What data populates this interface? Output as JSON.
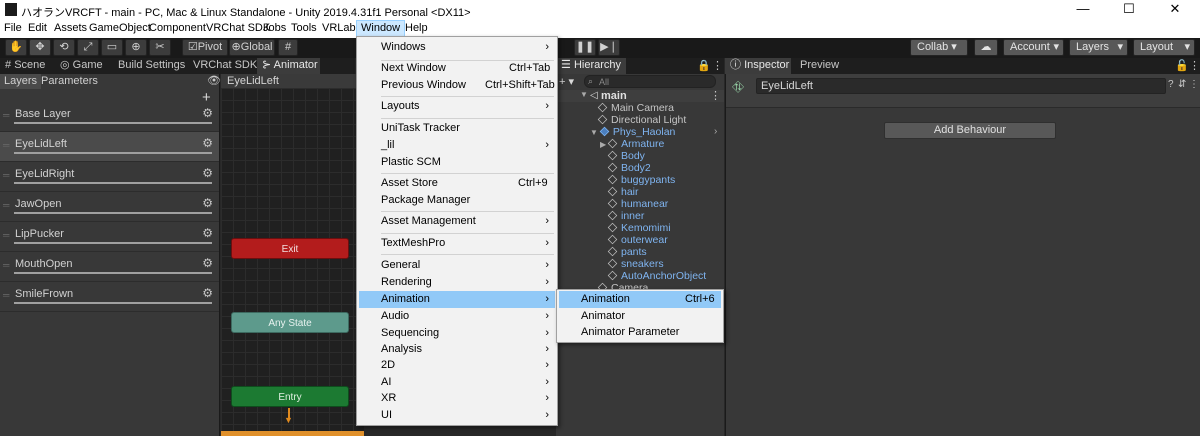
{
  "window": {
    "title": "ハオランVRCFT - main - PC, Mac & Linux Standalone - Unity 2019.4.31f1 Personal <DX11>",
    "minimize": "—",
    "maximize": "☐",
    "close": "✕"
  },
  "menubar": [
    "File",
    "Edit",
    "Assets",
    "GameObject",
    "Component",
    "VRChat SDK",
    "Jobs",
    "Tools",
    "VRLabs",
    "Window",
    "Help"
  ],
  "toolbar": {
    "pivot": "Pivot",
    "global": "Global",
    "collab": "Collab ▾",
    "account": "Account",
    "layers": "Layers",
    "layout": "Layout"
  },
  "tabs": [
    "Scene",
    "Game",
    "Build Settings",
    "VRChat SDK",
    "Animator"
  ],
  "animator": {
    "subtabs": [
      "Layers",
      "Parameters"
    ],
    "breadcrumb": "EyeLidLeft",
    "add": "+",
    "layers": [
      "Base Layer",
      "EyeLidLeft",
      "EyeLidRight",
      "JawOpen",
      "LipPucker",
      "MouthOpen",
      "SmileFrown"
    ],
    "selected_layer": 1,
    "nodes": {
      "exit": "Exit",
      "any_state": "Any State",
      "entry": "Entry"
    }
  },
  "window_menu": [
    {
      "label": "Windows",
      "submenu": true
    },
    {
      "sep": true
    },
    {
      "label": "Next Window",
      "shortcut": "Ctrl+Tab"
    },
    {
      "label": "Previous Window",
      "shortcut": "Ctrl+Shift+Tab"
    },
    {
      "sep": true
    },
    {
      "label": "Layouts",
      "submenu": true
    },
    {
      "sep": true
    },
    {
      "label": "UniTask Tracker"
    },
    {
      "label": "_lil",
      "submenu": true
    },
    {
      "label": "Plastic SCM"
    },
    {
      "sep": true
    },
    {
      "label": "Asset Store",
      "shortcut": "Ctrl+9"
    },
    {
      "label": "Package Manager"
    },
    {
      "sep": true
    },
    {
      "label": "Asset Management",
      "submenu": true
    },
    {
      "sep": true
    },
    {
      "label": "TextMeshPro",
      "submenu": true
    },
    {
      "sep": true
    },
    {
      "label": "General",
      "submenu": true
    },
    {
      "label": "Rendering",
      "submenu": true
    },
    {
      "label": "Animation",
      "submenu": true,
      "highlight": true
    },
    {
      "label": "Audio",
      "submenu": true
    },
    {
      "label": "Sequencing",
      "submenu": true
    },
    {
      "label": "Analysis",
      "submenu": true
    },
    {
      "label": "2D",
      "submenu": true
    },
    {
      "label": "AI",
      "submenu": true
    },
    {
      "label": "XR",
      "submenu": true
    },
    {
      "label": "UI",
      "submenu": true
    }
  ],
  "animation_submenu": [
    {
      "label": "Animation",
      "shortcut": "Ctrl+6",
      "highlight": true
    },
    {
      "label": "Animator"
    },
    {
      "label": "Animator Parameter"
    }
  ],
  "hierarchy": {
    "title": "Hierarchy",
    "add": "+ ▾",
    "search_placeholder": "All",
    "scene": "main",
    "items": [
      {
        "name": "Main Camera",
        "depth": 1,
        "prefab": false
      },
      {
        "name": "Directional Light",
        "depth": 1,
        "prefab": false
      },
      {
        "name": "Phys_Haolan",
        "depth": 1,
        "prefab": true,
        "expanded": true
      },
      {
        "name": "Armature",
        "depth": 2,
        "prefab": true,
        "collapsed": true
      },
      {
        "name": "Body",
        "depth": 2,
        "prefab": true
      },
      {
        "name": "Body2",
        "depth": 2,
        "prefab": true
      },
      {
        "name": "buggypants",
        "depth": 2,
        "prefab": true
      },
      {
        "name": "hair",
        "depth": 2,
        "prefab": true
      },
      {
        "name": "humanear",
        "depth": 2,
        "prefab": true
      },
      {
        "name": "inner",
        "depth": 2,
        "prefab": true
      },
      {
        "name": "Kemomimi",
        "depth": 2,
        "prefab": true
      },
      {
        "name": "outerwear",
        "depth": 2,
        "prefab": true
      },
      {
        "name": "pants",
        "depth": 2,
        "prefab": true
      },
      {
        "name": "sneakers",
        "depth": 2,
        "prefab": true
      },
      {
        "name": "AutoAnchorObject",
        "depth": 2,
        "prefab": true
      },
      {
        "name": "Camera",
        "depth": 1,
        "prefab": false
      }
    ]
  },
  "inspector": {
    "tabs": [
      "Inspector",
      "Preview"
    ],
    "object_name": "EyeLidLeft",
    "add_behaviour": "Add Behaviour"
  },
  "colors": {
    "exit": "#b31c1c",
    "any_state": "#5d9a8c",
    "entry": "#1c7a32",
    "menu_highlight": "#91c9f7",
    "prefab_text": "#7fb4f0"
  }
}
